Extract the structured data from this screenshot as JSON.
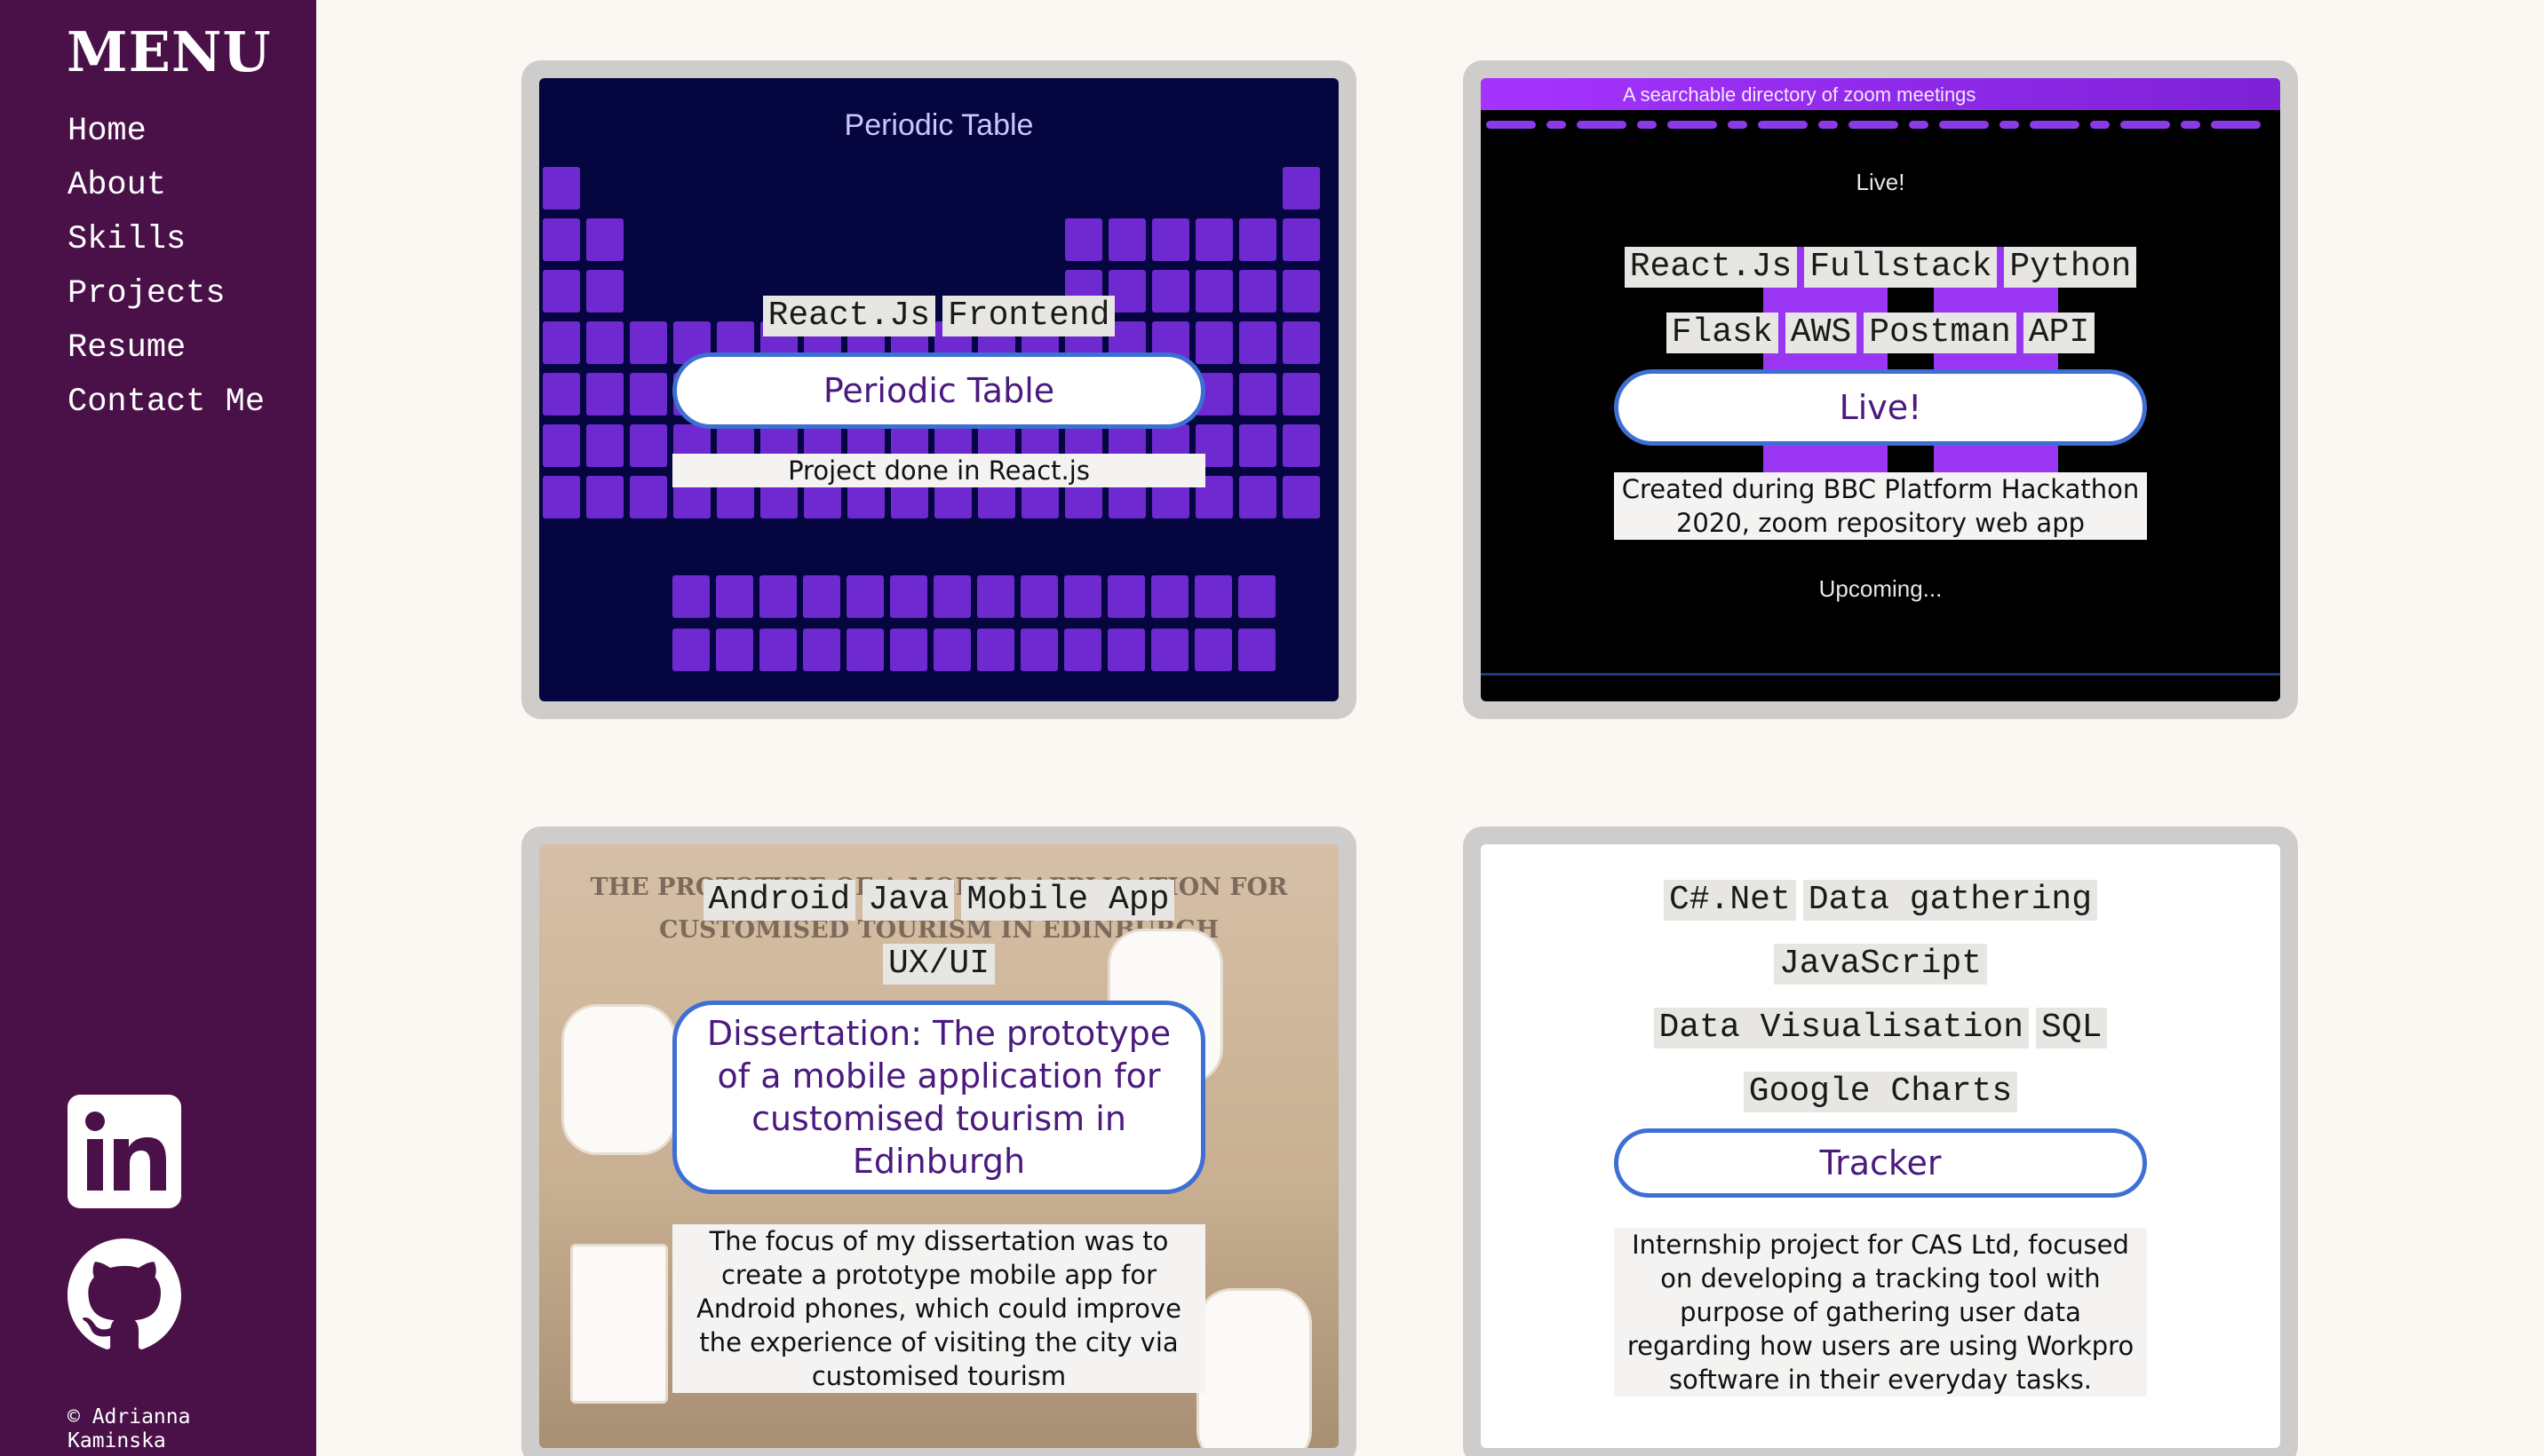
{
  "sidebar": {
    "title": "MENU",
    "nav": [
      "Home",
      "About",
      "Skills",
      "Projects",
      "Resume",
      "Contact Me"
    ],
    "copyright": "© Adrianna Kaminska"
  },
  "cards": [
    {
      "tag_rows": [
        [
          "React.Js",
          "Frontend"
        ]
      ],
      "title": "Periodic Table",
      "description": "Project done in React.js",
      "screenshot_text": "Periodic Table"
    },
    {
      "tag_rows": [
        [
          "React.Js",
          "Fullstack",
          "Python"
        ],
        [
          "Flask",
          "AWS",
          "Postman",
          "API"
        ]
      ],
      "title": "Live!",
      "description": "Created during BBC Platform Hackathon 2020, zoom repository web app",
      "screenshot_text": {
        "banner": "A searchable directory of zoom meetings",
        "live_heading": "Live!",
        "upcoming_heading": "Upcoming..."
      }
    },
    {
      "tag_rows": [
        [
          "Android",
          "Java",
          "Mobile App"
        ],
        [
          "UX/UI"
        ]
      ],
      "title": "Dissertation: The prototype of a mobile application for customised tourism in Edinburgh",
      "description": "The focus of my dissertation was to create a prototype mobile app for Android phones, which could improve the experience of visiting the city via customised tourism",
      "screenshot_text": "THE PROTOTYPE OF A MOBILE APPLICATION FOR CUSTOMISED TOURISM IN EDINBURGH"
    },
    {
      "tag_rows": [
        [
          "C#.Net",
          "Data gathering"
        ],
        [
          "JavaScript"
        ],
        [
          "Data Visualisation",
          "SQL"
        ],
        [
          "Google Charts"
        ]
      ],
      "title": "Tracker",
      "description": "Internship project for CAS Ltd, focused on developing a tracking tool with purpose of gathering user data regarding how users are using Workpro software in their everyday tasks."
    }
  ],
  "icons": [
    "linkedin-icon",
    "github-icon"
  ],
  "colors": {
    "sidebar_bg": "#4a1149",
    "page_bg": "#faf8f3",
    "button_border": "#3d6fd4",
    "button_text": "#4a1a7e"
  }
}
